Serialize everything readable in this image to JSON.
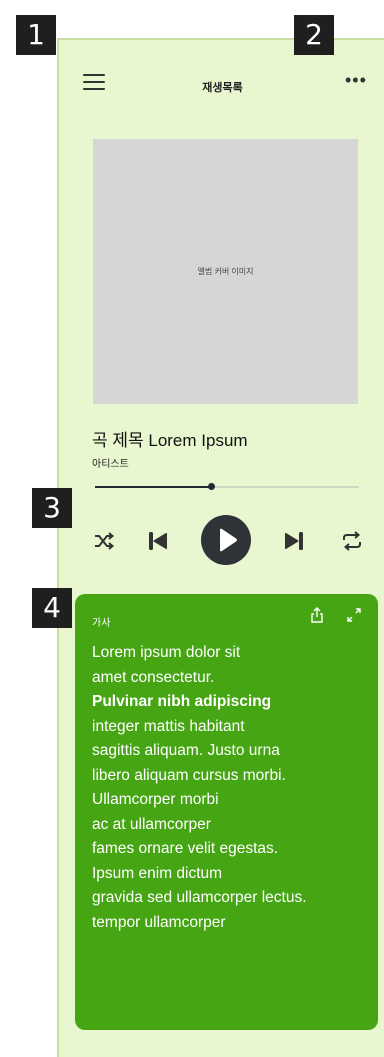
{
  "header": {
    "title": "재생목록"
  },
  "markers": [
    "1",
    "2",
    "3",
    "4"
  ],
  "album": {
    "cover_placeholder": "앨범 커버 이미지"
  },
  "track": {
    "title": "곡 제목 Lorem Ipsum",
    "artist": "아티스트",
    "progress": 0.44
  },
  "icons": {
    "menu": "hamburger-icon",
    "more": "more-horizontal-icon",
    "shuffle": "shuffle-icon",
    "previous": "skip-previous-icon",
    "play": "play-icon",
    "next": "skip-next-icon",
    "repeat": "repeat-icon",
    "share": "share-icon",
    "expand": "expand-icon"
  },
  "lyrics": {
    "label": "가사",
    "lines": [
      {
        "text": "Lorem ipsum dolor sit",
        "bold": false
      },
      {
        "text": "amet consectetur.",
        "bold": false
      },
      {
        "text": "Pulvinar nibh adipiscing",
        "bold": true
      },
      {
        "text": "integer mattis habitant",
        "bold": false
      },
      {
        "text": "sagittis aliquam. Justo urna",
        "bold": false
      },
      {
        "text": "libero aliquam cursus morbi.",
        "bold": false
      },
      {
        "text": "Ullamcorper morbi",
        "bold": false
      },
      {
        "text": "ac at ullamcorper",
        "bold": false
      },
      {
        "text": "fames ornare velit egestas.",
        "bold": false
      },
      {
        "text": "Ipsum enim dictum",
        "bold": false
      },
      {
        "text": "gravida sed ullamcorper lectus.",
        "bold": false
      },
      {
        "text": "tempor ullamcorper",
        "bold": false
      }
    ]
  },
  "colors": {
    "background": "#e8f7cf",
    "lyrics_card": "#46a513",
    "controls": "#333333"
  }
}
